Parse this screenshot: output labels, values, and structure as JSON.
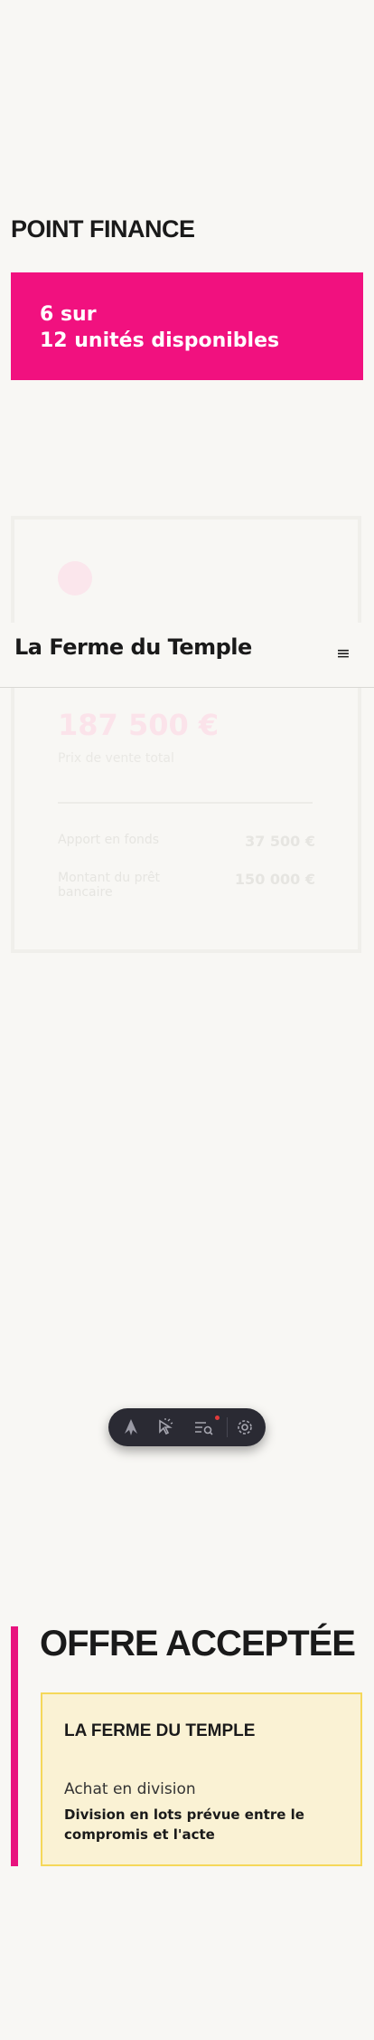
{
  "finance": {
    "title": "POINT FINANCE",
    "availability_line1": "6 sur",
    "availability_line2": "12 unités disponibles"
  },
  "price_card": {
    "price": "187 500 €",
    "subtitle": "Prix de vente total",
    "rows": [
      {
        "label": "Apport en fonds",
        "value": "37 500 €"
      },
      {
        "label": "Montant du prêt bancaire",
        "value": "150 000 €"
      }
    ]
  },
  "header": {
    "site_title": "La Ferme du Temple",
    "menu_icon": "≡"
  },
  "toolbar": {
    "icons": [
      "astro-logo-icon",
      "inspect-cursor-icon",
      "audit-list-icon",
      "settings-gear-icon"
    ]
  },
  "offer": {
    "title": "OFFRE ACCEPTÉE",
    "card": {
      "name": "LA FERME DU TEMPLE",
      "label": "Achat en division",
      "description": "Division en lots prévue entre le compromis et l'acte"
    }
  },
  "colors": {
    "accent_pink": "#f1117f",
    "card_yellow": "#faf2d4",
    "card_border": "#f5d85a",
    "background": "#f8f7f4"
  }
}
